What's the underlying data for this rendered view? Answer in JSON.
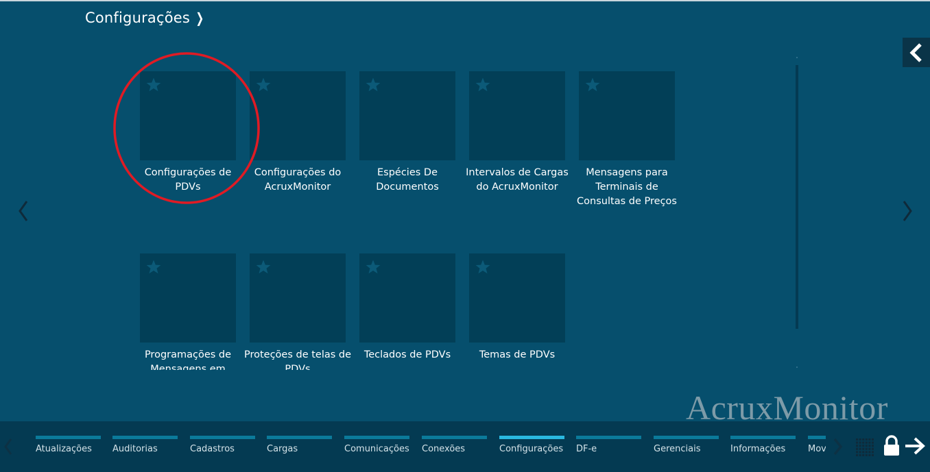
{
  "header": {
    "title": "Configurações"
  },
  "tiles": [
    {
      "label": "Configurações de PDVs"
    },
    {
      "label": "Configurações do AcruxMonitor"
    },
    {
      "label": "Espécies De Documentos"
    },
    {
      "label": "Intervalos de Cargas do AcruxMonitor"
    },
    {
      "label": "Mensagens para Terminais de Consultas de Preços"
    },
    {
      "label": "Programações de Mensagens em"
    },
    {
      "label": "Proteções de telas de PDVs"
    },
    {
      "label": "Teclados de PDVs"
    },
    {
      "label": "Temas de PDVs"
    }
  ],
  "watermark": "AcruxMonitor",
  "taskbar": {
    "items": [
      {
        "label": "Atualizações"
      },
      {
        "label": "Auditorias"
      },
      {
        "label": "Cadastros"
      },
      {
        "label": "Cargas"
      },
      {
        "label": "Comunicações"
      },
      {
        "label": "Conexões"
      },
      {
        "label": "Configurações",
        "active": true
      },
      {
        "label": "DF-e"
      },
      {
        "label": "Gerenciais"
      },
      {
        "label": "Informações"
      },
      {
        "label": "Mov"
      }
    ]
  },
  "colors": {
    "background": "#064f6d",
    "tile": "#023f57",
    "taskbar": "#043a52",
    "accent_active": "#2ab8e0",
    "accent": "#0b7a9a",
    "highlight": "#e01b24"
  }
}
